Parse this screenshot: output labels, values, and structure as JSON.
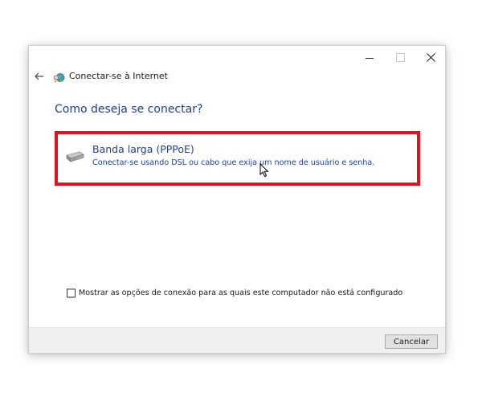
{
  "window": {
    "title": "Conectar-se à Internet",
    "caption_buttons": {
      "minimize_icon": "minimize-icon",
      "maximize_icon": "maximize-icon",
      "close_icon": "close-icon"
    }
  },
  "header": {
    "back_icon": "back-arrow-icon",
    "app_icon": "network-globe-icon"
  },
  "main": {
    "heading": "Como deseja se conectar?",
    "options": [
      {
        "title": "Banda larga (PPPoE)",
        "description": "Conectar-se usando DSL ou cabo que exija um nome de usuário e senha.",
        "icon": "broadband-modem-icon",
        "highlighted": true
      }
    ],
    "show_unconfigured": {
      "label": "Mostrar as opções de conexão para as quais este computador não está configurado",
      "checked": false
    }
  },
  "footer": {
    "cancel_label": "Cancelar"
  },
  "colors": {
    "accent_text": "#1f3f96",
    "highlight_border": "#e0131f",
    "footer_bg": "#f0f0f0"
  }
}
